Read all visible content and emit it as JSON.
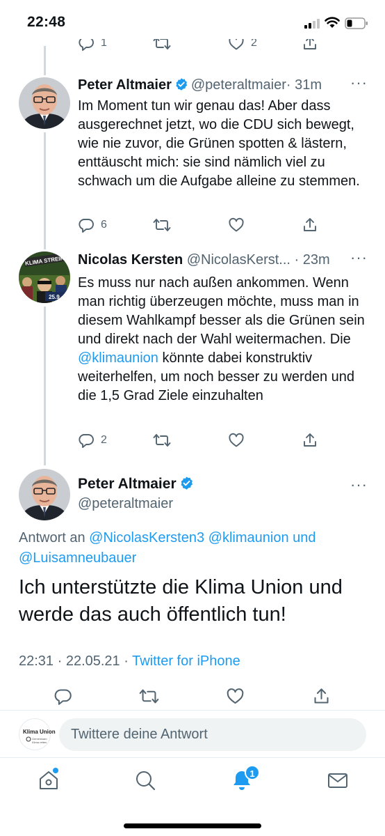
{
  "status_bar": {
    "time": "22:48"
  },
  "partial_tweet": {
    "reply_count": "1",
    "like_count": "2"
  },
  "tweets": [
    {
      "name": "Peter Altmaier",
      "handle": "@peteraltmaier",
      "time": "· 31m",
      "text": "Im Moment tun wir genau das! Aber dass ausgerechnet jetzt, wo die CDU sich bewegt, wie nie zuvor, die Grünen spotten & lästern, enttäuscht mich: sie sind nämlich viel zu schwach um die Aufgabe alleine zu stemmen.",
      "reply_count": "6"
    },
    {
      "name": "Nicolas Kersten",
      "handle": "@NicolasKerst...",
      "time": "· 23m",
      "text_before": "Es muss nur nach außen ankommen. Wenn man richtig überzeugen möchte, muss man in diesem Wahlkampf besser als die Grünen sein und direkt nach der Wahl weitermachen. Die ",
      "mention": "@klimaunion",
      "text_after": " könnte dabei konstruktiv weiterhelfen, um noch besser zu werden und die 1,5 Grad Ziele einzuhalten",
      "reply_count": "2",
      "avatar_text": "KLIMA STREIK",
      "avatar_date": "25.9."
    }
  ],
  "main_tweet": {
    "name": "Peter Altmaier",
    "handle": "@peteraltmaier",
    "reply_prefix": "Antwort an ",
    "reply_mentions": "@NicolasKersten3 @klimaunion und @Luisamneubauer",
    "text": "Ich unterstützte die Klima Union und werde das auch öffentlich tun!",
    "timestamp": "22:31 · 22.05.21 · ",
    "source": "Twitter for iPhone"
  },
  "reply_bar": {
    "avatar_label": "Klima Union",
    "avatar_sub": "Gemeinsam Klima retten",
    "placeholder": "Twittere deine Antwort"
  },
  "tab_bar": {
    "notifications_badge": "1"
  },
  "colors": {
    "accent": "#1d9bf0",
    "text": "#0f1419",
    "secondary": "#536471"
  }
}
